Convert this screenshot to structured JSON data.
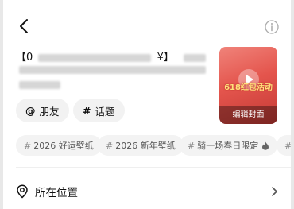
{
  "title": {
    "open_bracket": "【0",
    "yen": "¥】"
  },
  "cover": {
    "promo_text": "618红包活动",
    "edit_label": "编辑封面"
  },
  "mentions": [
    {
      "symbol": "@",
      "label": "朋友"
    },
    {
      "symbol": "#",
      "label": "话题"
    }
  ],
  "topic_tags": [
    {
      "hash": "#",
      "text": "2026 好运壁纸"
    },
    {
      "hash": "#",
      "text": "2026 新年壁纸"
    },
    {
      "hash": "#",
      "text": "骑一场春日限定"
    }
  ],
  "location": {
    "label": "所在位置"
  },
  "colors": {
    "cover_red": "#e4554d",
    "promo_yellow": "#ffe27a"
  }
}
